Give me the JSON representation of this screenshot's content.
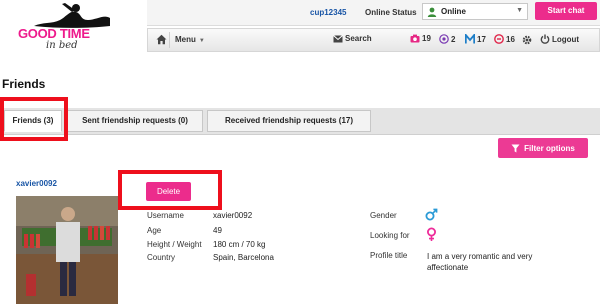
{
  "logo": {
    "line1": "GOOD TIME",
    "line2": "in bed"
  },
  "topbar": {
    "username": "cup12345",
    "online_status_label": "Online Status",
    "status_value": "Online",
    "start_chat": "Start chat"
  },
  "nav": {
    "menu": "Menu",
    "search": "Search",
    "photos_count": "19",
    "visitors_count": "2",
    "mail_count": "17",
    "likes_count": "16",
    "logout": "Logout"
  },
  "page": {
    "title": "Friends"
  },
  "tabs": [
    {
      "label": "Friends (3)",
      "active": true
    },
    {
      "label": "Sent friendship requests (0)",
      "active": false
    },
    {
      "label": "Received friendship requests (17)",
      "active": false
    }
  ],
  "filter_button": "Filter options",
  "profile": {
    "username_link": "xavier0092",
    "delete_label": "Delete",
    "fields": [
      {
        "label": "Username",
        "value": "xavier0092"
      },
      {
        "label": "Age",
        "value": "49"
      },
      {
        "label": "Height / Weight",
        "value": "180 cm / 70 kg"
      },
      {
        "label": "Country",
        "value": "Spain, Barcelona"
      }
    ],
    "gender_label": "Gender",
    "looking_for_label": "Looking for",
    "profile_title_label": "Profile title",
    "profile_title_value": "I am a very romantic and very affectionate"
  },
  "colors": {
    "accent": "#ec2c8c",
    "link": "#1a56a6",
    "highlight": "#ee0f1c",
    "male_icon": "#2a9ad6",
    "female_icon": "#ee2c9a"
  },
  "icons": [
    "user-icon",
    "home-icon",
    "envelope-icon",
    "camera-icon",
    "eye-icon",
    "mail-icon",
    "heart-icon",
    "gear-icon",
    "power-icon",
    "funnel-icon",
    "male-icon",
    "female-icon"
  ]
}
